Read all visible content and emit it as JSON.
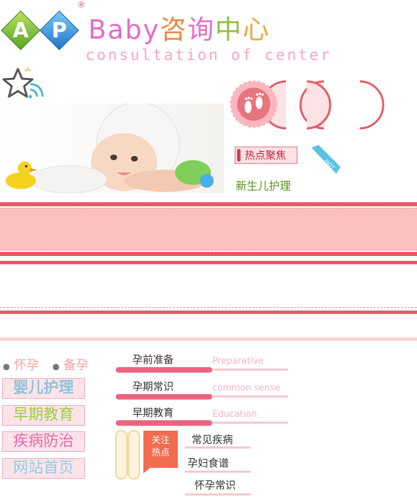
{
  "logo": {
    "title_latin": "Baby",
    "title_chars": [
      "咨",
      "询",
      "中",
      "心"
    ],
    "subtitle": "consultation of  center",
    "registered_mark": "®",
    "badge_letters": [
      "A",
      "P"
    ]
  },
  "hot": {
    "label": "热点聚焦",
    "tag": "HOT",
    "link": "新生儿护理"
  },
  "sidebar": {
    "header_items": [
      "怀孕",
      "备孕"
    ],
    "buttons": [
      "婴儿护理",
      "早期教育",
      "疾病防治",
      "网站首页"
    ]
  },
  "tabs": [
    {
      "label": "孕前准备",
      "en": "Preparative"
    },
    {
      "label": "孕期常识",
      "en": "common sense"
    },
    {
      "label": "早期教育",
      "en": "Education"
    }
  ],
  "focus": {
    "tag_line1": "关注",
    "tag_line2": "热点",
    "links": [
      "常见疾病",
      "孕妇食谱",
      "怀孕常识"
    ]
  },
  "colors": {
    "accent": "#ea6680",
    "band": "#fdc0c0",
    "band_border": "#e55b65"
  }
}
